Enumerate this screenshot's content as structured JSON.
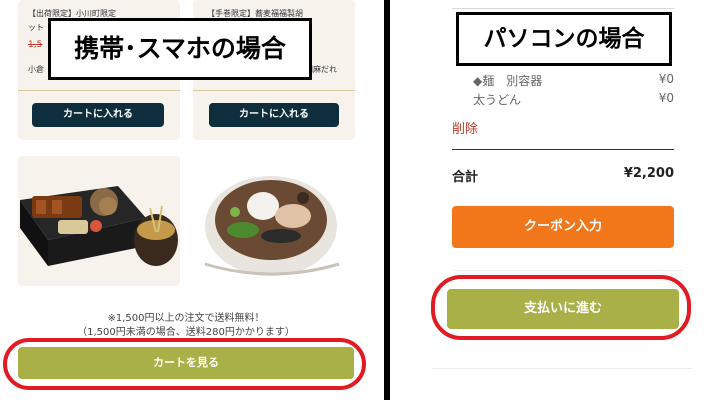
{
  "mobile": {
    "overlay_label": "携帯･スマホの場合",
    "products": [
      {
        "name_line1": "【出荷限定】小川町限定",
        "name_line2": "ット",
        "price_strike": "1,5",
        "detail": "小倉",
        "cart_label": "カートに入れる"
      },
      {
        "name_line1": "【手巻限定】蕎麦福福製胡",
        "name_line2": "",
        "price_strike": "",
        "detail": "胡麻だれ",
        "cart_label": "カートに入れる"
      }
    ],
    "shipping_notice_line1": "※1,500円以上の注文で送料無料！",
    "shipping_notice_line2": "（1,500円未満の場合、送料280円かかります）",
    "view_cart_label": "カートを見る"
  },
  "desktop": {
    "overlay_label": "パソコンの場合",
    "items": [
      {
        "name": "◆麺　別容器",
        "price": "¥0"
      },
      {
        "name": "太うどん",
        "price": "¥0"
      }
    ],
    "delete_label": "削除",
    "total_label": "合計",
    "total_value": "¥2,200",
    "coupon_label": "クーポン入力",
    "pay_label": "支払いに進む"
  },
  "colors": {
    "navy": "#0f2e3d",
    "olive": "#a9b047",
    "orange": "#f2771a",
    "highlight_red": "#e01b24"
  }
}
